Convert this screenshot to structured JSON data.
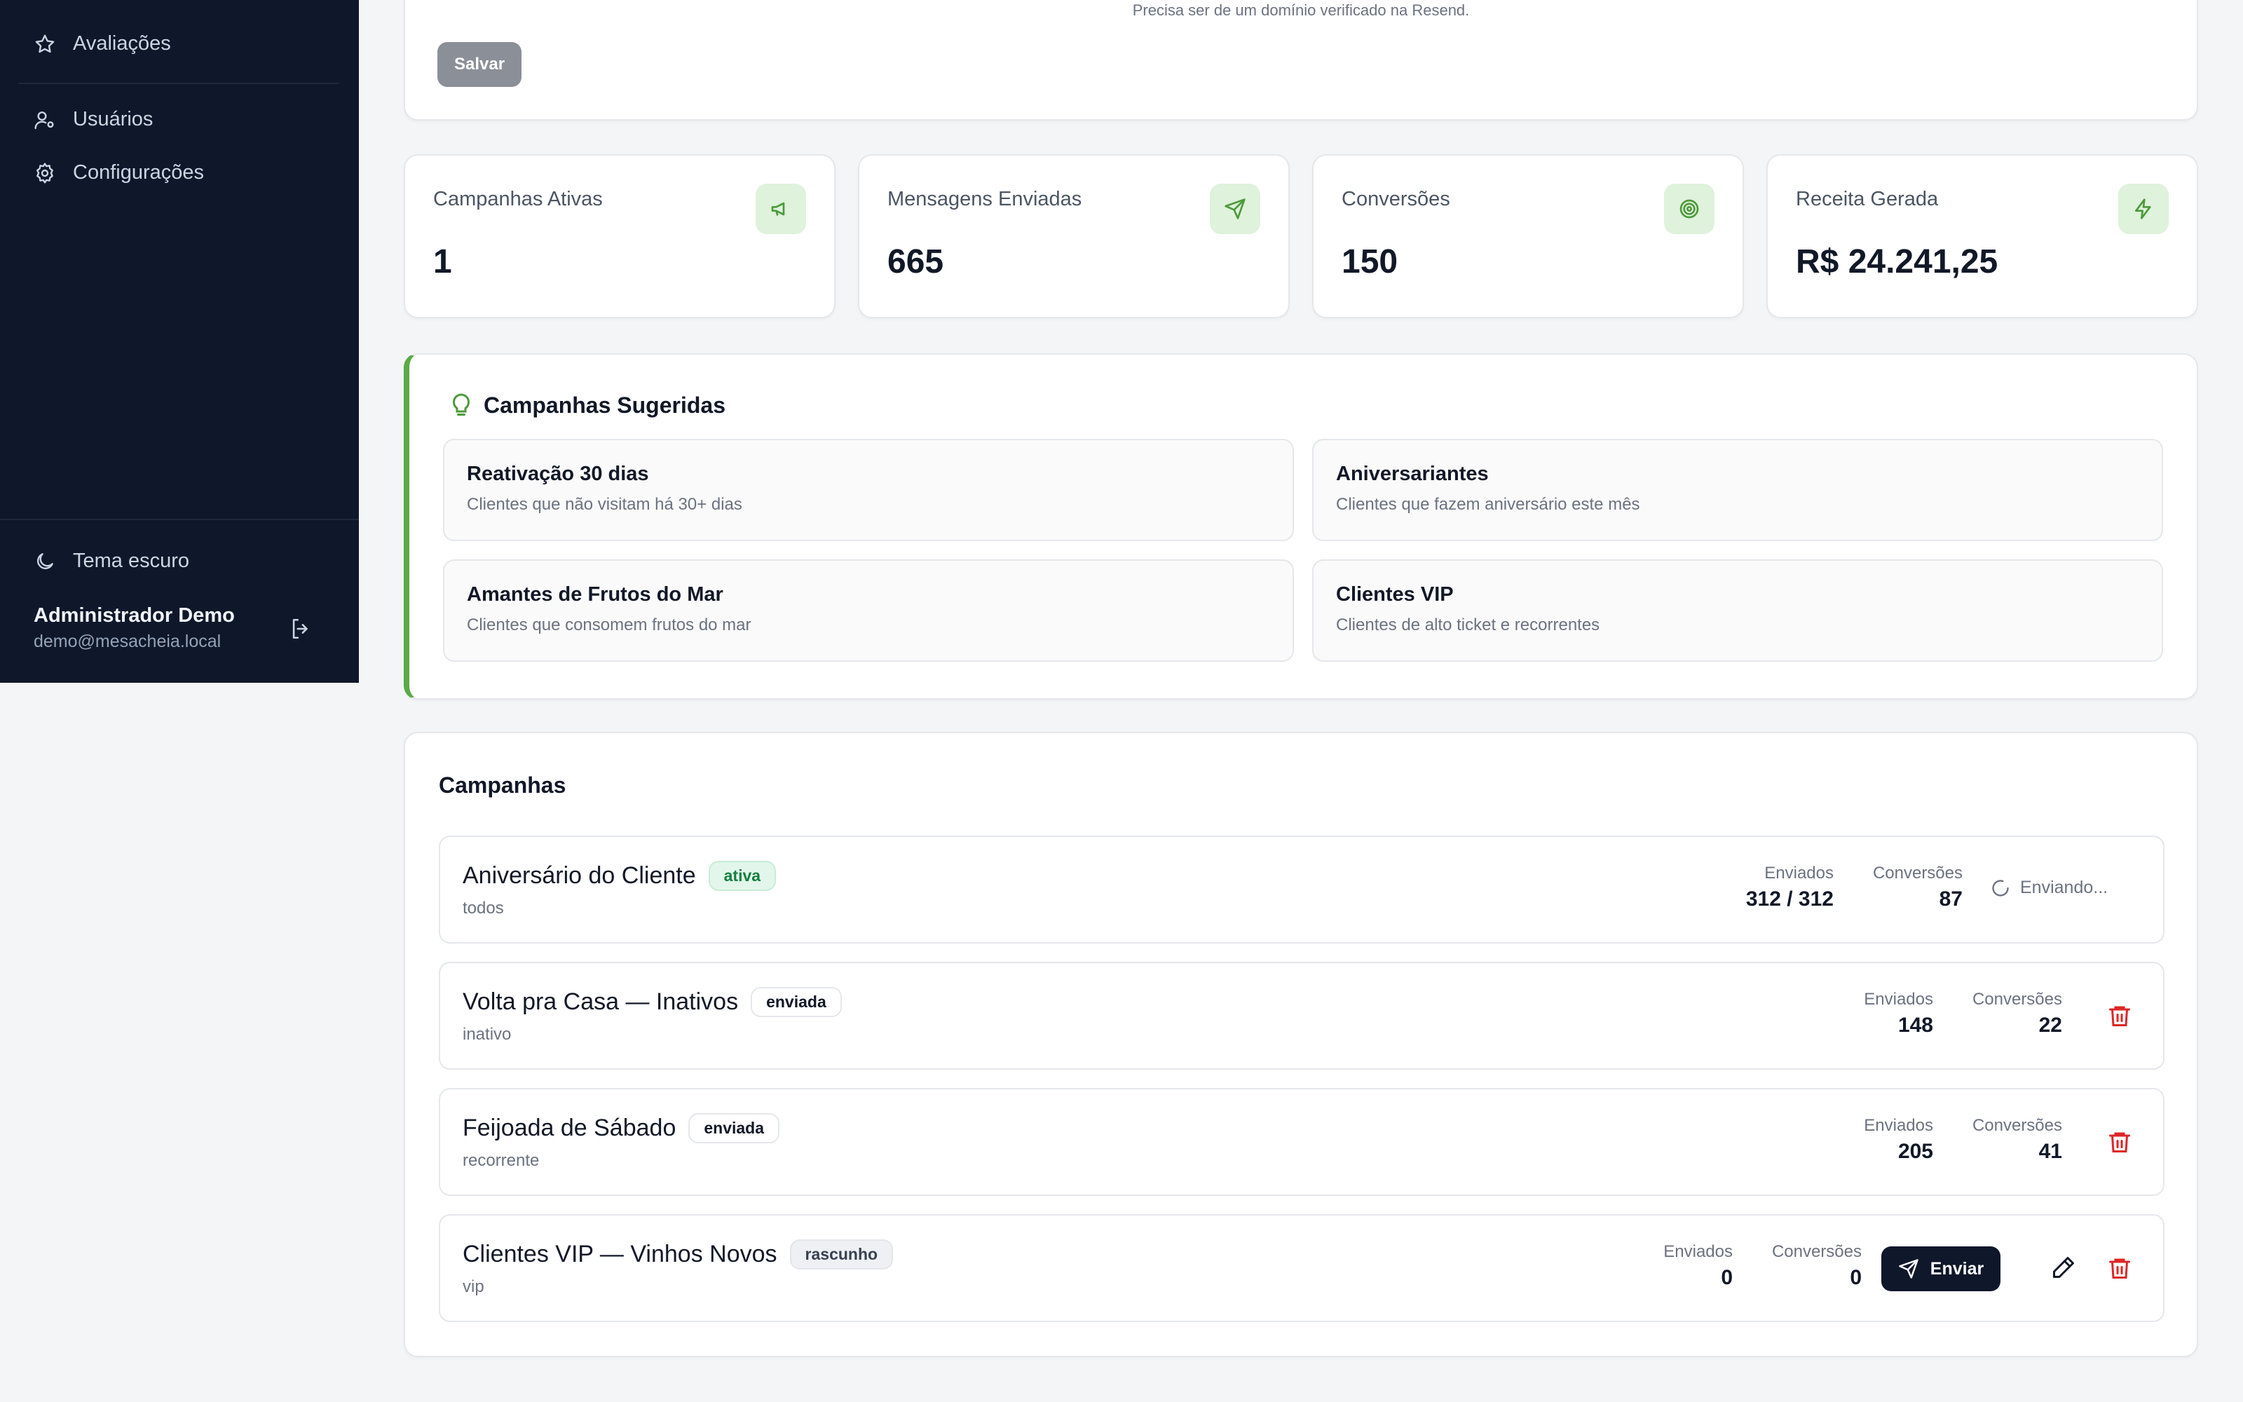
{
  "sidebar": {
    "items": [
      {
        "label": "Avaliações",
        "icon": "star-icon"
      },
      {
        "label": "Usuários",
        "icon": "user-cog-icon"
      },
      {
        "label": "Configurações",
        "icon": "gear-icon"
      }
    ],
    "theme_toggle": "Tema escuro",
    "user": {
      "name": "Administrador Demo",
      "email": "demo@mesacheia.local"
    }
  },
  "settings": {
    "hint": "Precisa ser de um domínio verificado na Resend.",
    "save_label": "Salvar"
  },
  "stats": [
    {
      "label": "Campanhas Ativas",
      "value": "1",
      "icon": "megaphone-icon"
    },
    {
      "label": "Mensagens Enviadas",
      "value": "665",
      "icon": "send-icon"
    },
    {
      "label": "Conversões",
      "value": "150",
      "icon": "target-icon"
    },
    {
      "label": "Receita Gerada",
      "value": "R$ 24.241,25",
      "icon": "zap-icon"
    }
  ],
  "suggestions": {
    "title": "Campanhas Sugeridas",
    "items": [
      {
        "title": "Reativação 30 dias",
        "desc": "Clientes que não visitam há 30+ dias"
      },
      {
        "title": "Aniversariantes",
        "desc": "Clientes que fazem aniversário este mês"
      },
      {
        "title": "Amantes de Frutos do Mar",
        "desc": "Clientes que consomem frutos do mar"
      },
      {
        "title": "Clientes VIP",
        "desc": "Clientes de alto ticket e recorrentes"
      }
    ]
  },
  "campaigns": {
    "title": "Campanhas",
    "sent_label": "Enviados",
    "conv_label": "Conversões",
    "sending_label": "Enviando...",
    "send_label": "Enviar",
    "rows": [
      {
        "name": "Aniversário do Cliente",
        "status": "ativa",
        "segment": "todos",
        "sent": "312 / 312",
        "conversions": "87"
      },
      {
        "name": "Volta pra Casa — Inativos",
        "status": "enviada",
        "segment": "inativo",
        "sent": "148",
        "conversions": "22"
      },
      {
        "name": "Feijoada de Sábado",
        "status": "enviada",
        "segment": "recorrente",
        "sent": "205",
        "conversions": "41"
      },
      {
        "name": "Clientes VIP — Vinhos Novos",
        "status": "rascunho",
        "segment": "vip",
        "sent": "0",
        "conversions": "0"
      }
    ]
  },
  "colors": {
    "sidebar_bg": "#0f172a",
    "accent_green": "#5aaa46",
    "danger": "#dc2626"
  }
}
